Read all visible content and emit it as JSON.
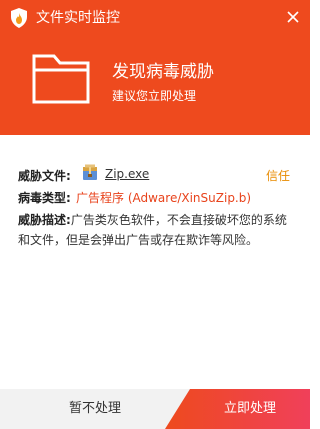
{
  "window": {
    "title": "文件实时监控"
  },
  "alert": {
    "title": "发现病毒威胁",
    "subtitle": "建议您立即处理"
  },
  "details": {
    "file_label": "威胁文件:",
    "file_name": "Zip.exe",
    "trust_label": "信任",
    "type_label": "病毒类型:",
    "type_value": "广告程序 (Adware/XinSuZip.b)",
    "desc_label": "威胁描述:",
    "desc_text": "广告类灰色软件，不会直接破坏您的系统和文件，但是会弹出广告或存在欺诈等风险。"
  },
  "actions": {
    "ignore_label": "暂不处理",
    "handle_label": "立即处理"
  },
  "colors": {
    "header": "#ee4a1e",
    "accent": "#e8431c",
    "trust": "#e88b00",
    "footer_bg": "#f2f2f2"
  },
  "icons": {
    "app": "shield-flame-icon",
    "close": "close-icon",
    "folder": "folder-icon",
    "file": "archive-file-icon"
  }
}
